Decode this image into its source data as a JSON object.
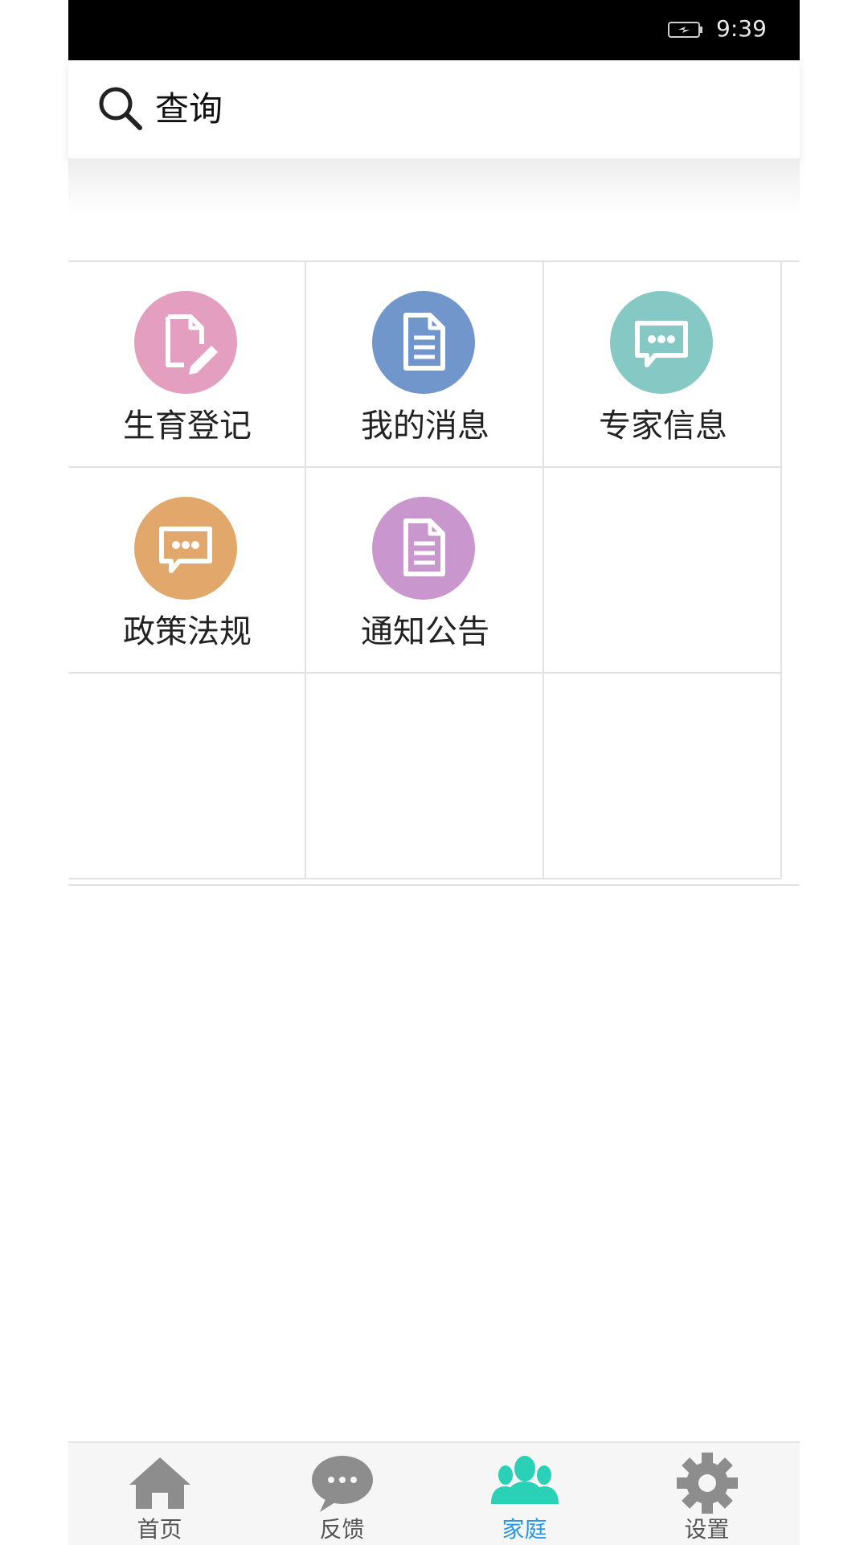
{
  "status_bar": {
    "time": "9:39"
  },
  "search": {
    "label": "查询"
  },
  "grid": {
    "items": [
      {
        "label": "生育登记",
        "color": "#e49fc0",
        "icon": "document-edit-icon"
      },
      {
        "label": "我的消息",
        "color": "#7096cc",
        "icon": "document-icon"
      },
      {
        "label": "专家信息",
        "color": "#86c9c4",
        "icon": "chat-bubble-icon"
      },
      {
        "label": "政策法规",
        "color": "#e2a86b",
        "icon": "chat-bubble-icon"
      },
      {
        "label": "通知公告",
        "color": "#c996cd",
        "icon": "document-icon"
      }
    ]
  },
  "tabs": [
    {
      "label": "首页",
      "icon": "home-icon"
    },
    {
      "label": "反馈",
      "icon": "chat-bubble-icon"
    },
    {
      "label": "家庭",
      "icon": "people-icon",
      "active": true,
      "active_color": "#2ad1b6"
    },
    {
      "label": "设置",
      "icon": "gear-icon"
    }
  ]
}
